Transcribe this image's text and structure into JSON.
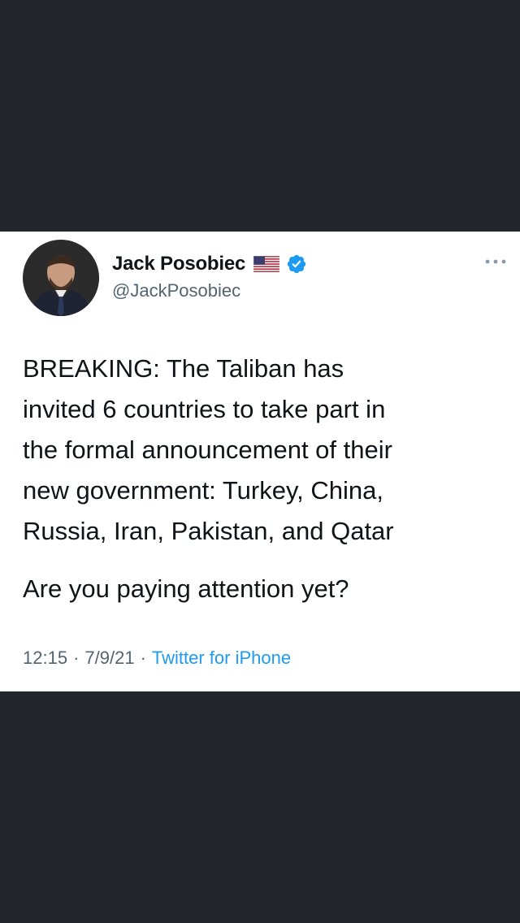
{
  "tweet": {
    "display_name": "Jack Posobiec",
    "handle": "@JackPosobiec",
    "text_paragraph_1": "BREAKING: The Taliban has\ninvited 6 countries to take part in\nthe formal announcement of their\nnew government: Turkey, China,\nRussia, Iran, Pakistan, and Qatar",
    "text_paragraph_2": "Are you paying attention yet?",
    "time": "12:15",
    "date": "7/9/21",
    "source": "Twitter for iPhone",
    "separator": "·"
  },
  "icons": {
    "flag": "us-flag-icon",
    "verified": "verified-badge-icon",
    "more": "more-options-icon"
  },
  "colors": {
    "background": "#25262b",
    "card": "#ffffff",
    "text": "#0f1419",
    "secondary_text": "#536471",
    "link": "#1d9bf0",
    "verified": "#1d9bf0"
  }
}
